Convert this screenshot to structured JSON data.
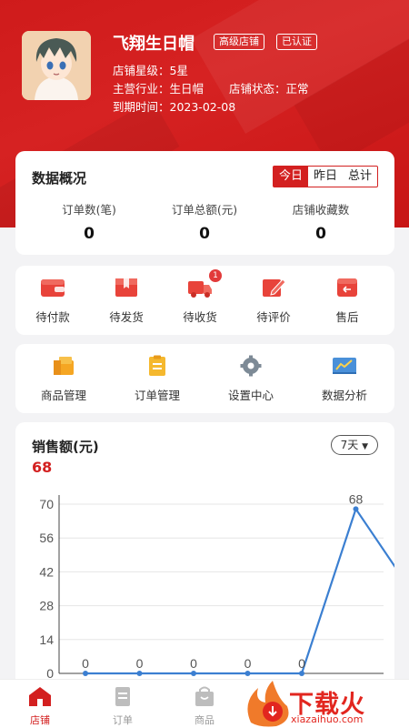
{
  "store": {
    "name": "飞翔生日帽",
    "badges": [
      "高级店铺",
      "已认证"
    ],
    "rating_line": "店铺星级：5星",
    "industry_line": "主营行业：生日帽",
    "status_line": "店铺状态：正常",
    "expiry_line": "到期时间：2023-02-08"
  },
  "overview": {
    "title": "数据概况",
    "tabs": [
      "今日",
      "昨日",
      "总计"
    ],
    "active_tab": "今日",
    "stats": [
      {
        "label": "订单数(笔)",
        "value": "0"
      },
      {
        "label": "订单总额(元)",
        "value": "0"
      },
      {
        "label": "店铺收藏数",
        "value": "0"
      }
    ]
  },
  "orders": [
    {
      "label": "待付款",
      "icon": "wallet-icon"
    },
    {
      "label": "待发货",
      "icon": "package-icon"
    },
    {
      "label": "待收货",
      "icon": "truck-icon",
      "badge": "1"
    },
    {
      "label": "待评价",
      "icon": "review-pen-icon"
    },
    {
      "label": "售后",
      "icon": "after-sale-icon"
    }
  ],
  "quick": [
    {
      "label": "商品管理",
      "icon": "goods-box-icon"
    },
    {
      "label": "订单管理",
      "icon": "clipboard-icon"
    },
    {
      "label": "设置中心",
      "icon": "gear-icon"
    },
    {
      "label": "数据分析",
      "icon": "chart-board-icon"
    }
  ],
  "sales": {
    "title": "销售额(元)",
    "total": "68",
    "range": "7天"
  },
  "chart_data": {
    "type": "line",
    "x": [
      1,
      2,
      3,
      4,
      5,
      6,
      7
    ],
    "values": [
      0,
      0,
      0,
      0,
      0,
      68,
      35
    ],
    "data_labels": [
      "0",
      "0",
      "0",
      "0",
      "0",
      "68",
      ""
    ],
    "yticks": [
      0,
      14,
      28,
      42,
      56,
      70
    ],
    "ylim": [
      0,
      70
    ],
    "grid": true,
    "line_color": "#3b7fd1"
  },
  "tabbar": [
    {
      "label": "店铺",
      "icon": "store-icon",
      "active": true
    },
    {
      "label": "订单",
      "icon": "order-doc-icon",
      "active": false
    },
    {
      "label": "商品",
      "icon": "shopping-bag-icon",
      "active": false
    }
  ],
  "watermark": {
    "brand": "下载火",
    "site": "xiazaihuo.com"
  },
  "colors": {
    "primary": "#d32020",
    "line": "#3b7fd1",
    "background": "#f3f3f5"
  }
}
